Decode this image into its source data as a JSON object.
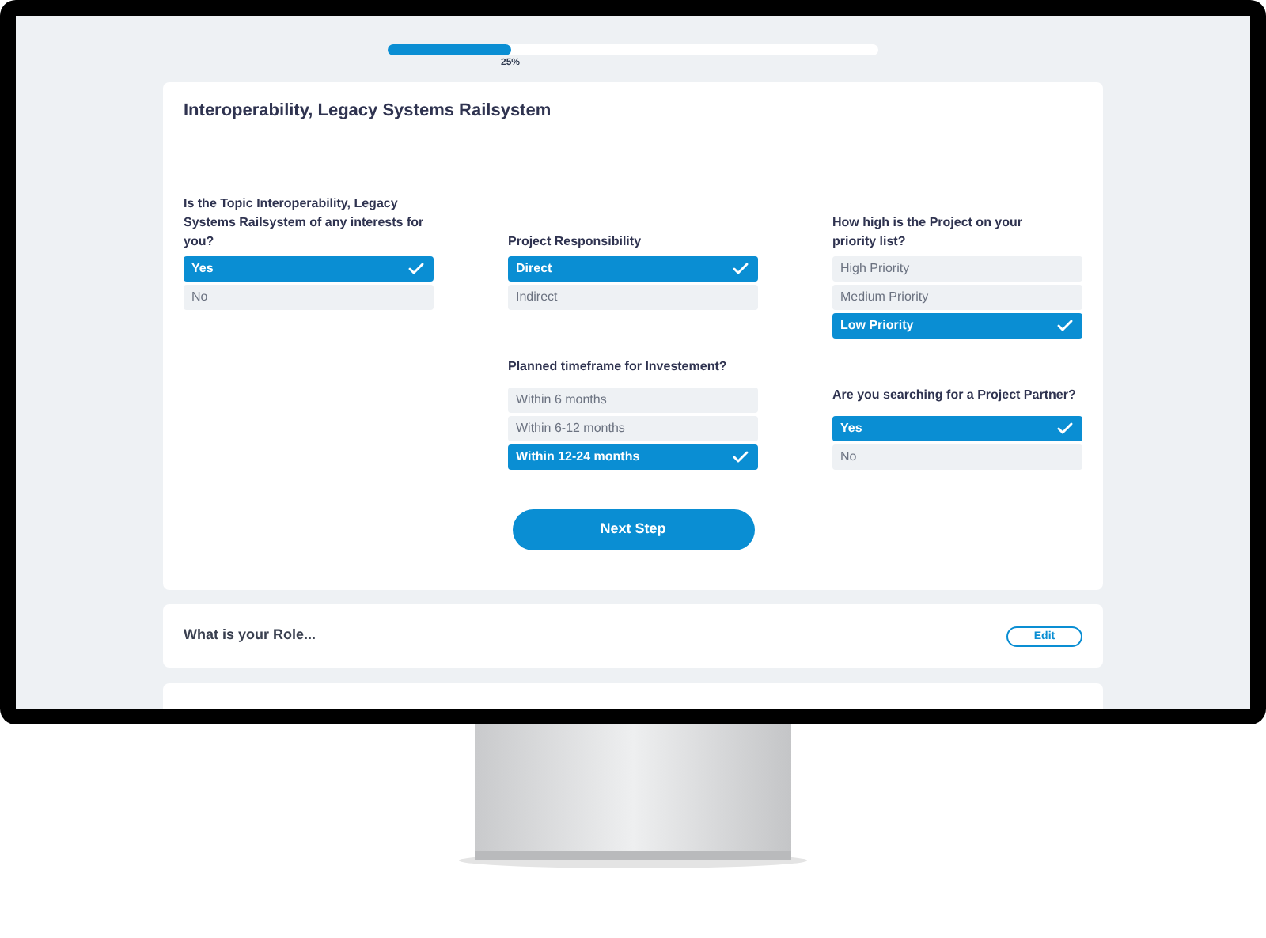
{
  "progress": {
    "level": 0.25,
    "label": "25%"
  },
  "card": {
    "title": "Interoperability, Legacy Systems Railsystem",
    "columns": [
      {
        "questions": [
          {
            "label": "Is the Topic Interoperability, Legacy Systems Railsystem of any interests for you?",
            "options": [
              {
                "label": "Yes",
                "selected": true
              },
              {
                "label": "No",
                "selected": false
              }
            ]
          }
        ]
      },
      {
        "questions": [
          {
            "label": "Project Responsibility",
            "options": [
              {
                "label": "Direct",
                "selected": true
              },
              {
                "label": "Indirect",
                "selected": false
              }
            ]
          },
          {
            "label": "Planned timeframe for Investement?",
            "options": [
              {
                "label": "Within 6 months",
                "selected": false
              },
              {
                "label": "Within 6-12 months",
                "selected": false
              },
              {
                "label": "Within 12-24 months",
                "selected": true
              }
            ]
          }
        ]
      },
      {
        "questions": [
          {
            "label": "How high is the Project on your priority list?",
            "options": [
              {
                "label": "High Priority",
                "selected": false
              },
              {
                "label": "Medium Priority",
                "selected": false
              },
              {
                "label": "Low Priority",
                "selected": true
              }
            ]
          },
          {
            "label": "Are you searching for a Project Partner?",
            "options": [
              {
                "label": "Yes",
                "selected": true
              },
              {
                "label": "No",
                "selected": false
              }
            ]
          }
        ]
      }
    ],
    "button": "Next Step"
  },
  "sections": [
    {
      "title": "What is your Role...",
      "button": "Edit"
    }
  ]
}
